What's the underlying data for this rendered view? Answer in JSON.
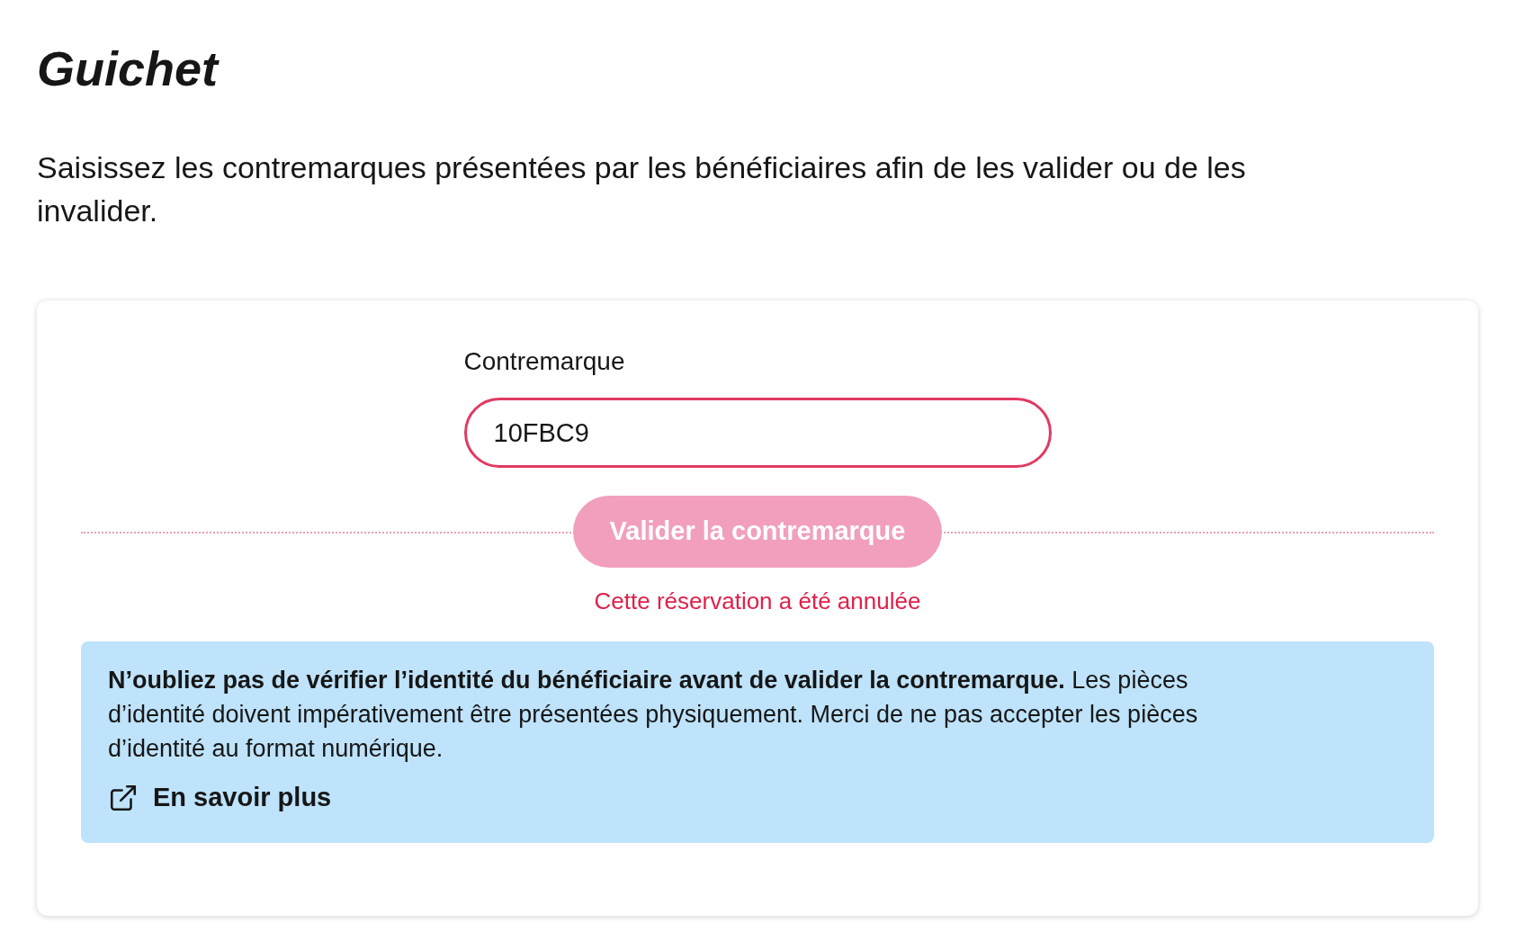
{
  "page": {
    "title": "Guichet",
    "intro": "Saisissez les contremarques présentées par les bénéficiaires afin de les valider ou de les invalider."
  },
  "form": {
    "field": {
      "label": "Contremarque",
      "value": "10FBC9",
      "error": true
    },
    "submit": {
      "label": "Valider la contremarque",
      "disabled": true
    },
    "error_message": "Cette réservation a été annulée"
  },
  "notice": {
    "text": "**N’oubliez pas de vérifier l’identité du bénéficiaire avant de valider la contremarque.** Les pièces d’identité doivent impérativement être présentées physiquement. Merci de ne pas accepter les pièces d’identité au format numérique.",
    "link": "En savoir plus"
  }
}
